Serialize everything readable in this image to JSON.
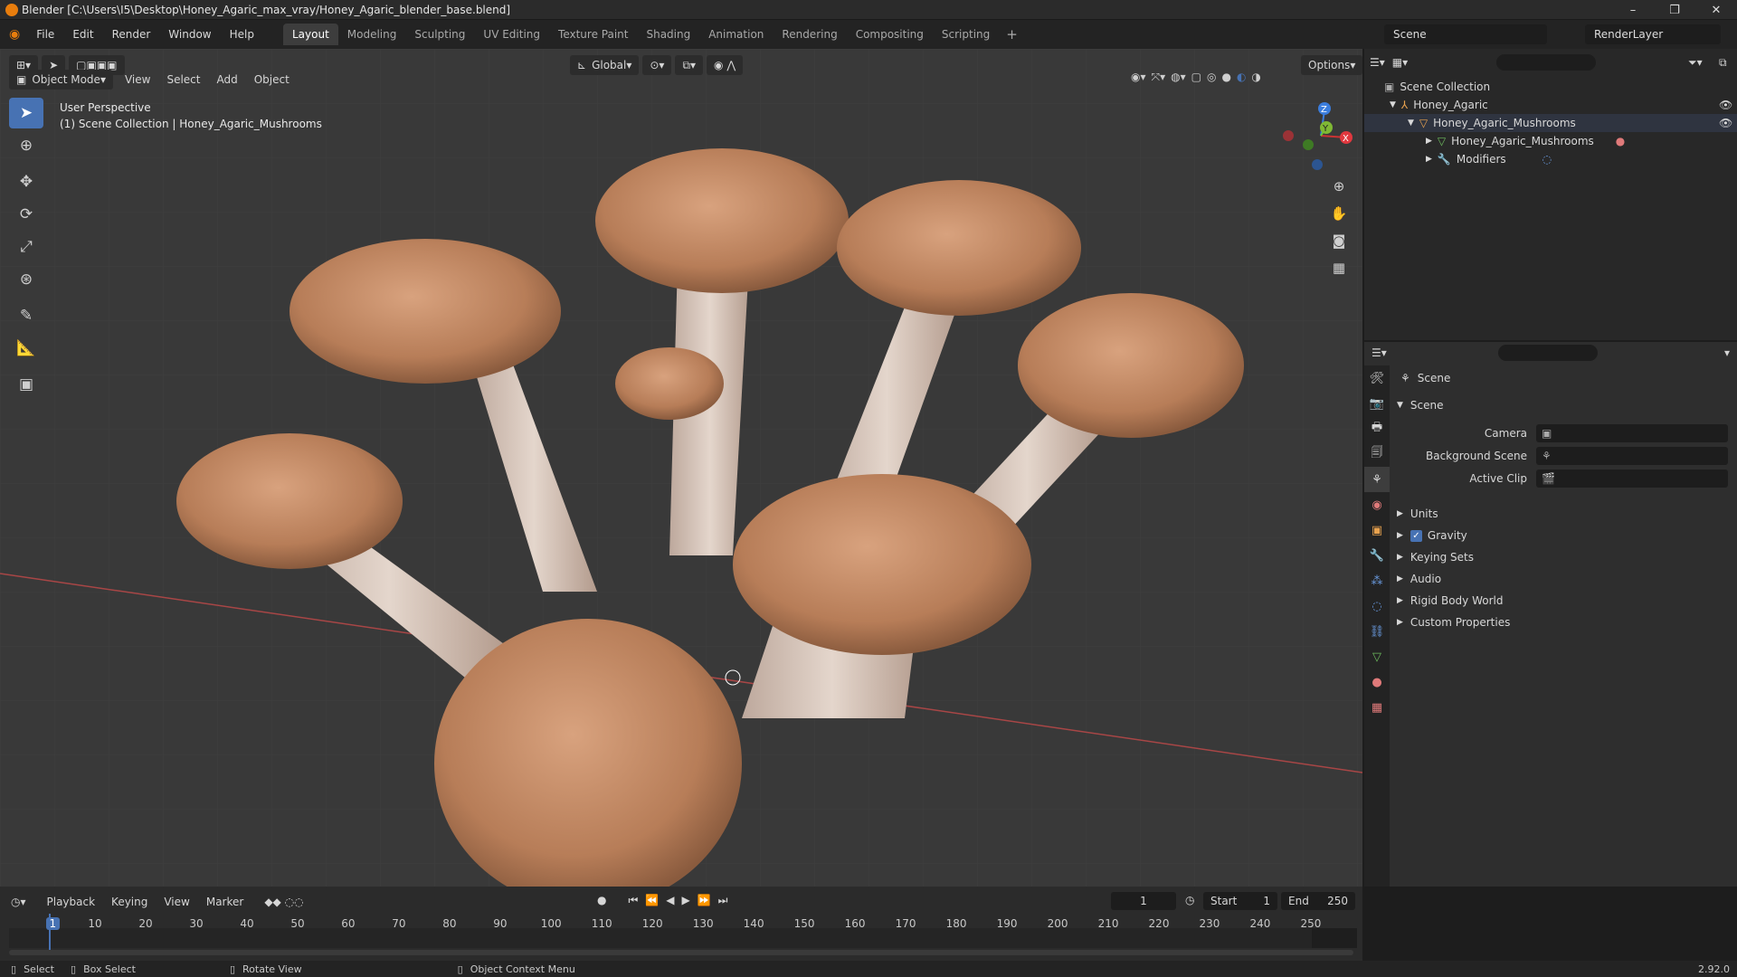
{
  "window": {
    "title": "Blender [C:\\Users\\I5\\Desktop\\Honey_Agaric_max_vray/Honey_Agaric_blender_base.blend]"
  },
  "menu": [
    "File",
    "Edit",
    "Render",
    "Window",
    "Help"
  ],
  "workspaces": [
    "Layout",
    "Modeling",
    "Sculpting",
    "UV Editing",
    "Texture Paint",
    "Shading",
    "Animation",
    "Rendering",
    "Compositing",
    "Scripting"
  ],
  "active_workspace": "Layout",
  "scene_field": "Scene",
  "renderlayer_field": "RenderLayer",
  "viewport_header": {
    "mode": "Object Mode",
    "menus": [
      "View",
      "Select",
      "Add",
      "Object"
    ],
    "orientation": "Global",
    "options": "Options"
  },
  "viewport_info": {
    "line1": "User Perspective",
    "line2": "(1) Scene Collection | Honey_Agaric_Mushrooms"
  },
  "gizmo": {
    "x": "X",
    "y": "Y",
    "z": "Z"
  },
  "outliner": {
    "root": "Scene Collection",
    "items": [
      {
        "label": "Honey_Agaric",
        "level": 1
      },
      {
        "label": "Honey_Agaric_Mushrooms",
        "level": 2
      },
      {
        "label": "Honey_Agaric_Mushrooms",
        "level": 3
      },
      {
        "label": "Modifiers",
        "level": 3
      }
    ]
  },
  "properties": {
    "title": "Scene",
    "section": "Scene",
    "fields": [
      {
        "label": "Camera"
      },
      {
        "label": "Background Scene"
      },
      {
        "label": "Active Clip"
      }
    ],
    "panels": [
      "Units",
      "Gravity",
      "Keying Sets",
      "Audio",
      "Rigid Body World",
      "Custom Properties"
    ],
    "gravity_checked": true
  },
  "timeline": {
    "menus": [
      "Playback",
      "Keying",
      "View",
      "Marker"
    ],
    "current_frame": "1",
    "start_label": "Start",
    "start": "1",
    "end_label": "End",
    "end": "250",
    "ticks": [
      "1",
      "10",
      "20",
      "30",
      "40",
      "50",
      "60",
      "70",
      "80",
      "90",
      "100",
      "110",
      "120",
      "130",
      "140",
      "150",
      "160",
      "170",
      "180",
      "190",
      "200",
      "210",
      "220",
      "230",
      "240",
      "250"
    ]
  },
  "statusbar": {
    "select": "Select",
    "box_select": "Box Select",
    "rotate": "Rotate View",
    "context": "Object Context Menu",
    "version": "2.92.0"
  }
}
